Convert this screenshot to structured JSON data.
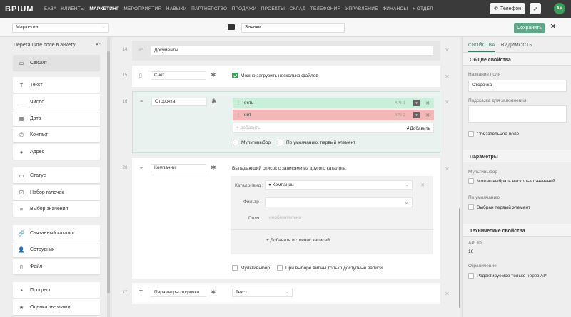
{
  "topbar": {
    "logo": "BPIUM",
    "nav": [
      "БАЗА",
      "КЛИЕНТЫ",
      "МАРКЕТИНГ",
      "МЕРОПРИЯТИЯ",
      "НАВЫКИ",
      "ПАРТНЕРСТВО",
      "ПРОДАЖИ",
      "ПРОЕКТЫ",
      "СКЛАД",
      "ТЕЛЕФОНИЯ",
      "УПРАВЛЕНИЕ",
      "ФИНАНСЫ",
      "+ ОТДЕЛ"
    ],
    "active": "МАРКЕТИНГ",
    "phone_label": "Телефон",
    "avatar": "АМ"
  },
  "subbar": {
    "section_select": "Маркетинг",
    "catalog_name": "Заявки",
    "save_label": "Сохранить",
    "close": "✕"
  },
  "left_panel": {
    "title": "Перетащите поле в анкету",
    "items": [
      {
        "label": "Секция",
        "icon": "section-icon",
        "glyph": "▭"
      },
      {
        "label": "Текст",
        "icon": "text-icon",
        "glyph": "T"
      },
      {
        "label": "Число",
        "icon": "number-icon",
        "glyph": "—"
      },
      {
        "label": "Дата",
        "icon": "calendar-icon",
        "glyph": "▦"
      },
      {
        "label": "Контакт",
        "icon": "phone-icon",
        "glyph": "✆"
      },
      {
        "label": "Адрес",
        "icon": "pin-icon",
        "glyph": "●"
      },
      {
        "label": "Статус",
        "icon": "status-icon",
        "glyph": "▭"
      },
      {
        "label": "Набор галочек",
        "icon": "checkboxes-icon",
        "glyph": "☑"
      },
      {
        "label": "Выбор значения",
        "icon": "list-icon",
        "glyph": "≡"
      },
      {
        "label": "Связанный каталог",
        "icon": "link-icon",
        "glyph": "🔗"
      },
      {
        "label": "Сотрудник",
        "icon": "user-icon",
        "glyph": "👤"
      },
      {
        "label": "Файл",
        "icon": "file-icon",
        "glyph": "▯"
      },
      {
        "label": "Прогресс",
        "icon": "progress-icon",
        "glyph": "◔"
      },
      {
        "label": "Оценка звездами",
        "icon": "star-icon",
        "glyph": "★"
      }
    ]
  },
  "form": {
    "rows": [
      {
        "num": "14",
        "label": "Документы"
      },
      {
        "num": "15",
        "label": "Счет",
        "option": "Можно загрузить несколько файлов"
      },
      {
        "num": "16",
        "label": "Отсрочка",
        "options": [
          {
            "label": "есть",
            "api": "API: 1"
          },
          {
            "label": "нет",
            "api": "API: 2"
          }
        ],
        "add_placeholder": "+ добавить",
        "add_button": "Добавить",
        "multi": "Мультивыбор",
        "default": "По умолчанию: первый элемент"
      },
      {
        "num": "20",
        "label": "Компании",
        "desc": "Выпадающий список с записями из другого каталога:",
        "catalog_label": "Каталог/вид :",
        "catalog_value": "Компании",
        "filter_label": "Фильтр :",
        "fields_label": "Поля :",
        "fields_placeholder": "необязательно",
        "add_source": "+ Добавить источник записей",
        "multi": "Мультивыбор",
        "visible": "При выборе видны только доступные записи"
      },
      {
        "num": "17",
        "label": "Параметры отсрочки",
        "type": "Текст"
      }
    ]
  },
  "right_panel": {
    "tabs": [
      "СВОЙСТВА",
      "ВИДИМОСТЬ"
    ],
    "general_title": "Общие свойства",
    "field_name_label": "Название поля",
    "field_name_value": "Отсрочка",
    "hint_label": "Подсказка для заполнения",
    "hint_value": "",
    "required": "Обязательное поле",
    "params_title": "Параметры",
    "multi_label": "Мультивыбор",
    "multi_value": "Можно выбрать несколько значений",
    "default_label": "По умолчанию",
    "default_value": "Выбран первый элемент",
    "tech_title": "Технические свойства",
    "api_label": "API ID",
    "api_value": "16",
    "limit_label": "Ограничение",
    "limit_value": "Редактируемое только через API"
  },
  "colors": {
    "accent": "#5fa78b",
    "option_green": "#c8f0d8",
    "option_red": "#f3b7b7"
  }
}
